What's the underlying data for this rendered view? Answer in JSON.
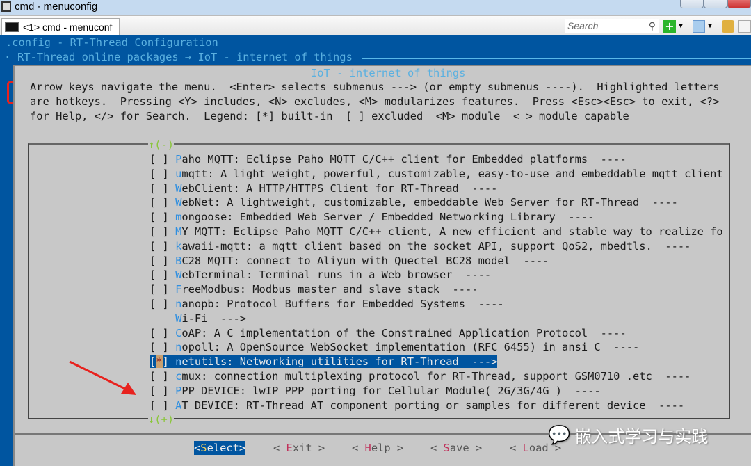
{
  "window": {
    "title": "cmd - menuconfig"
  },
  "tab": {
    "label": "<1> cmd - menuconf"
  },
  "toolbar": {
    "search_placeholder": "Search",
    "icons": [
      "search-icon",
      "add-console-icon",
      "console-list-icon",
      "lock-icon"
    ]
  },
  "terminal": {
    "config_title": ".config - RT-Thread Configuration",
    "breadcrumb": "RT-Thread online packages → IoT - internet of things",
    "dialog_title": "IoT - internet of things",
    "help": [
      "Arrow keys navigate the menu.  <Enter> selects submenus ---> (or empty submenus ----).  Highlighted letters",
      "are hotkeys.  Pressing <Y> includes, <N> excludes, <M> modularizes features.  Press <Esc><Esc> to exit, <?>",
      "for Help, </> for Search.  Legend: [*] built-in  [ ] excluded  <M> module  < > module capable"
    ],
    "scroll_up": "↑(-)",
    "scroll_down": "↓(+)",
    "items": [
      {
        "check": "[ ] ",
        "key": "P",
        "rest": "aho MQTT: Eclipse Paho MQTT C/C++ client for Embedded platforms  ----"
      },
      {
        "check": "[ ] ",
        "key": "u",
        "rest": "mqtt: A light weight, powerful, customizable, easy-to-use and embeddable mqtt client"
      },
      {
        "check": "[ ] ",
        "key": "W",
        "rest": "ebClient: A HTTP/HTTPS Client for RT-Thread  ----"
      },
      {
        "check": "[ ] ",
        "key": "W",
        "rest": "ebNet: A lightweight, customizable, embeddable Web Server for RT-Thread  ----"
      },
      {
        "check": "[ ] ",
        "key": "m",
        "rest": "ongoose: Embedded Web Server / Embedded Networking Library  ----"
      },
      {
        "check": "[ ] ",
        "key": "M",
        "rest": "Y MQTT: Eclipse Paho MQTT C/C++ client, A new efficient and stable way to realize fo"
      },
      {
        "check": "[ ] ",
        "key": "k",
        "rest": "awaii-mqtt: a mqtt client based on the socket API, support QoS2, mbedtls.  ----"
      },
      {
        "check": "[ ] ",
        "key": "B",
        "rest": "C28 MQTT: connect to Aliyun with Quectel BC28 model  ----"
      },
      {
        "check": "[ ] ",
        "key": "W",
        "rest": "ebTerminal: Terminal runs in a Web browser  ----"
      },
      {
        "check": "[ ] ",
        "key": "F",
        "rest": "reeModbus: Modbus master and slave stack  ----"
      },
      {
        "check": "[ ] ",
        "key": "n",
        "rest": "anopb: Protocol Buffers for Embedded Systems  ----"
      },
      {
        "check": "    ",
        "key": "W",
        "rest": "i-Fi  --->"
      },
      {
        "check": "[ ] ",
        "key": "C",
        "rest": "oAP: A C implementation of the Constrained Application Protocol  ----"
      },
      {
        "check": "[ ] ",
        "key": "n",
        "rest": "opoll: A OpenSource WebSocket implementation (RFC 6455) in ansi C  ----"
      },
      {
        "check": "[*] ",
        "key": "n",
        "rest": "etutils: Networking utilities for RT-Thread  --->",
        "selected": true
      },
      {
        "check": "[ ] ",
        "key": "c",
        "rest": "mux: connection multiplexing protocol for RT-Thread, support GSM0710 .etc  ----"
      },
      {
        "check": "[ ] ",
        "key": "P",
        "rest": "PP DEVICE: lwIP PPP porting for Cellular Module( 2G/3G/4G )  ----"
      },
      {
        "check": "[ ] ",
        "key": "A",
        "rest": "T DEVICE: RT-Thread AT component porting or samples for different device  ----"
      }
    ],
    "buttons": [
      {
        "pre": "<",
        "key": "S",
        "rest": "elect",
        "post": ">",
        "active": true
      },
      {
        "pre": "< ",
        "key": "E",
        "rest": "xit",
        "post": " >"
      },
      {
        "pre": "< ",
        "key": "H",
        "rest": "elp",
        "post": " >"
      },
      {
        "pre": "< ",
        "key": "S",
        "rest": "ave",
        "post": " >"
      },
      {
        "pre": "< ",
        "key": "L",
        "rest": "oad",
        "post": " >"
      }
    ]
  },
  "watermark": {
    "text": "嵌入式学习与实践",
    "icon": "wechat-icon"
  },
  "colors": {
    "terminal_blue": "#0055a0",
    "dialog_gray": "#c8c8c8",
    "hotkey": "#2f8fe0",
    "highlight_box": "#e8221e"
  }
}
